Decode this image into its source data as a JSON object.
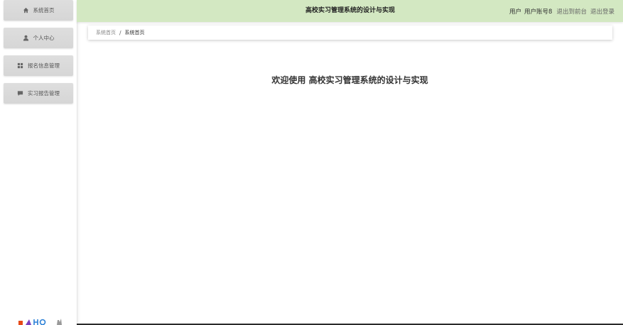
{
  "sidebar": {
    "items": [
      {
        "label": "系统首页",
        "icon": "home-icon"
      },
      {
        "label": "个人中心",
        "icon": "user-icon"
      },
      {
        "label": "报名信息管理",
        "icon": "grid-icon"
      },
      {
        "label": "实习报告管理",
        "icon": "chat-icon"
      }
    ]
  },
  "header": {
    "title": "高校实习管理系统的设计与实现",
    "role": "用户",
    "username": "用户账号8",
    "back_link": "退出到前台",
    "logout_link": "退出登录",
    "background_color": "#d3e8c2"
  },
  "breadcrumb": {
    "home": "系统首页",
    "separator": "/",
    "current": "系统首页"
  },
  "main": {
    "welcome_prefix": "欢迎使用",
    "welcome_title": "高校实习管理系统的设计与实现"
  }
}
